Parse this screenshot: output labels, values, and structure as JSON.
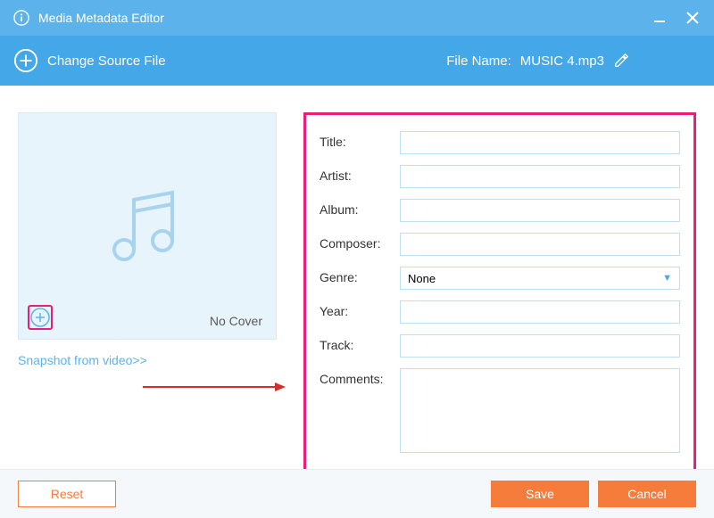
{
  "titlebar": {
    "title": "Media Metadata Editor"
  },
  "toolbar": {
    "change_source_label": "Change Source File",
    "file_name_label": "File Name:",
    "file_name_value": "MUSIC 4.mp3"
  },
  "cover": {
    "no_cover_label": "No Cover",
    "snapshot_link": "Snapshot from video>>"
  },
  "fields": {
    "title_label": "Title:",
    "title_value": "",
    "artist_label": "Artist:",
    "artist_value": "",
    "album_label": "Album:",
    "album_value": "",
    "composer_label": "Composer:",
    "composer_value": "",
    "genre_label": "Genre:",
    "genre_value": "None",
    "year_label": "Year:",
    "year_value": "",
    "track_label": "Track:",
    "track_value": "",
    "comments_label": "Comments:",
    "comments_value": ""
  },
  "footer": {
    "reset_label": "Reset",
    "save_label": "Save",
    "cancel_label": "Cancel"
  }
}
